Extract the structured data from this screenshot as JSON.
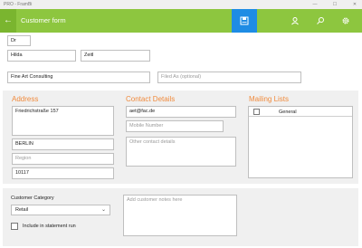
{
  "window": {
    "title": "PRO - FramBi",
    "minimize": "—",
    "maximize": "☐",
    "close": "✕"
  },
  "appbar": {
    "back": "←",
    "title": "Customer form",
    "save_icon": "save-icon",
    "contact_icon": "person-icon",
    "search_icon": "search-icon",
    "settings_icon": "gear-icon"
  },
  "colors": {
    "appbar": "#8dc63f",
    "accent_blue": "#1e8ce4",
    "section_orange": "#f08a3c"
  },
  "name": {
    "title": "Dr",
    "first_name": "Hilda",
    "last_name": "Zeitl"
  },
  "company": {
    "name": "Fine Art Consulting",
    "filed_as_placeholder": "Filed As (optional)"
  },
  "address": {
    "heading": "Address",
    "street": "Friedrichstraße 157",
    "city": "BERLIN",
    "region_placeholder": "Region",
    "postcode": "10117"
  },
  "contact": {
    "heading": "Contact Details",
    "email": "aet@fac.de",
    "mobile_placeholder": "Mobile Number",
    "other_placeholder": "Other contact details"
  },
  "mailing_lists": {
    "heading": "Mailing Lists",
    "items": [
      {
        "label": "General",
        "checked": false
      }
    ]
  },
  "category": {
    "label": "Customer Category",
    "selected": "Retail",
    "statement_label": "Include in statement run",
    "statement_checked": false,
    "notes_placeholder": "Add customer notes here"
  }
}
